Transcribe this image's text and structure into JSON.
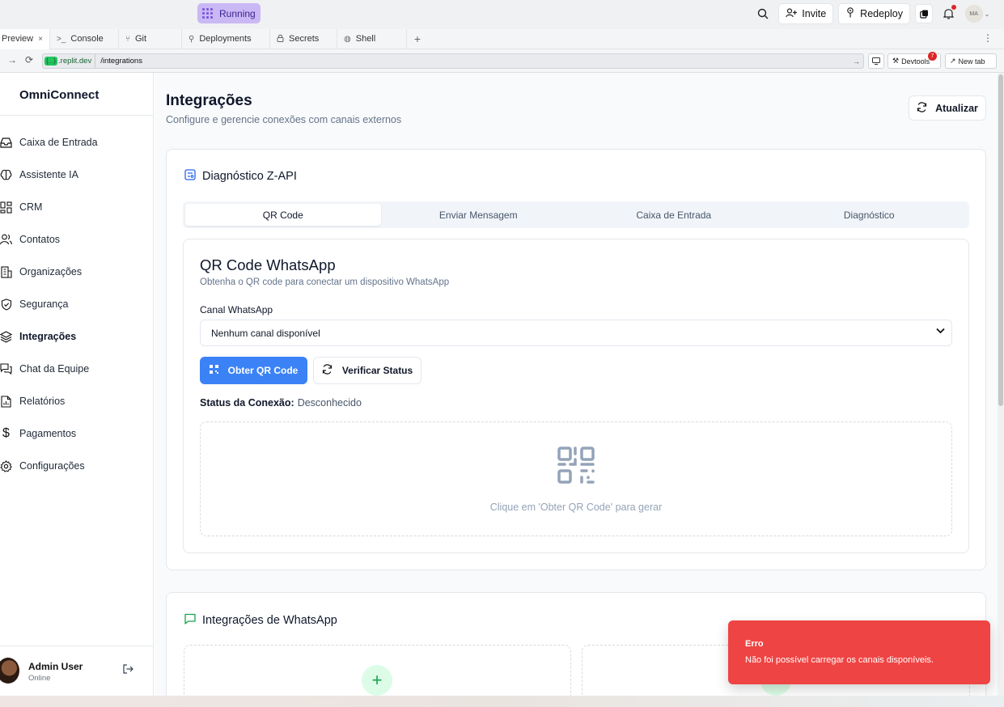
{
  "replit": {
    "status_label": "Running",
    "invite_label": "Invite",
    "redeploy_label": "Redeploy",
    "avatar_initials": "MA",
    "tabs": [
      {
        "label": "Preview",
        "icon": "close-icon"
      },
      {
        "label": "Console",
        "icon": "terminal-icon"
      },
      {
        "label": "Git",
        "icon": "git-icon"
      },
      {
        "label": "Deployments",
        "icon": "deploy-icon"
      },
      {
        "label": "Secrets",
        "icon": "lock-icon"
      },
      {
        "label": "Shell",
        "icon": "shell-icon"
      }
    ],
    "url_domain": ".replit.dev",
    "url_path": "/integrations",
    "devtools_label": "Devtools",
    "devtools_badge": "7",
    "newtab_label": "New tab"
  },
  "sidebar": {
    "brand": "OmniConnect",
    "items": [
      {
        "label": "Caixa de Entrada",
        "icon": "inbox-icon"
      },
      {
        "label": "Assistente IA",
        "icon": "brain-icon"
      },
      {
        "label": "CRM",
        "icon": "grid-icon"
      },
      {
        "label": "Contatos",
        "icon": "users-icon"
      },
      {
        "label": "Organizações",
        "icon": "building-icon"
      },
      {
        "label": "Segurança",
        "icon": "shield-icon"
      },
      {
        "label": "Integrações",
        "icon": "layers-icon",
        "active": true
      },
      {
        "label": "Chat da Equipe",
        "icon": "chat-icon"
      },
      {
        "label": "Relatórios",
        "icon": "report-icon"
      },
      {
        "label": "Pagamentos",
        "icon": "dollar-icon"
      },
      {
        "label": "Configurações",
        "icon": "gear-icon"
      }
    ],
    "user": {
      "name": "Admin User",
      "status": "Online"
    }
  },
  "main": {
    "title": "Integrações",
    "subtitle": "Configure e gerencie conexões com canais externos",
    "refresh_label": "Atualizar",
    "diagnostic": {
      "title": "Diagnóstico Z-API",
      "tabs": [
        "QR Code",
        "Enviar Mensagem",
        "Caixa de Entrada",
        "Diagnóstico"
      ],
      "active_tab": "QR Code",
      "panel": {
        "title": "QR Code WhatsApp",
        "subtitle": "Obtenha o QR code para conectar um dispositivo WhatsApp",
        "channel_label": "Canal WhatsApp",
        "channel_value": "Nenhum canal disponível",
        "get_qr_label": "Obter QR Code",
        "verify_label": "Verificar Status",
        "status_label": "Status da Conexão:",
        "status_value": "Desconhecido",
        "hint": "Clique em 'Obter QR Code' para gerar"
      }
    },
    "whatsapp": {
      "title": "Integrações de WhatsApp"
    }
  },
  "toast": {
    "title": "Erro",
    "message": "Não foi possível carregar os canais disponíveis."
  },
  "colors": {
    "primary": "#3b82f6",
    "error": "#ef4444",
    "running": "#c9b8f4",
    "success": "#16a34a"
  }
}
